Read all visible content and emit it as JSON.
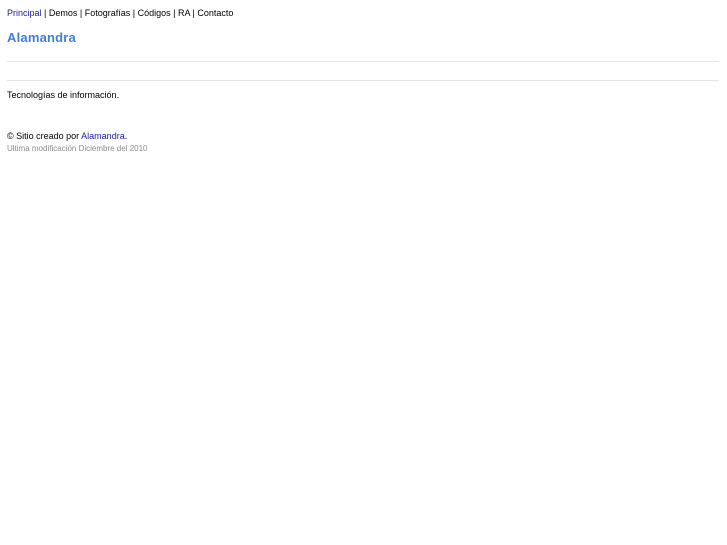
{
  "nav": {
    "items": [
      {
        "label": "Principal",
        "active": true
      },
      {
        "label": "Demos",
        "active": false
      },
      {
        "label": "Fotografías",
        "active": false
      },
      {
        "label": "Códigos",
        "active": false
      },
      {
        "label": "RA",
        "active": false
      },
      {
        "label": "Contacto",
        "active": false
      }
    ],
    "separator": " | "
  },
  "header": {
    "site_title": "Alamandra"
  },
  "main": {
    "tagline": "Tecnologías de información."
  },
  "footer": {
    "credit_prefix": "© Sitio creado por ",
    "credit_link": "Alamandra",
    "credit_suffix": ".",
    "modified": "Ultima modificación Diciembre del 2010"
  },
  "colors": {
    "title": "#3f7fd6",
    "link": "#1a1aa6",
    "muted": "#8c8c8c",
    "divider": "#e6e6e6"
  }
}
